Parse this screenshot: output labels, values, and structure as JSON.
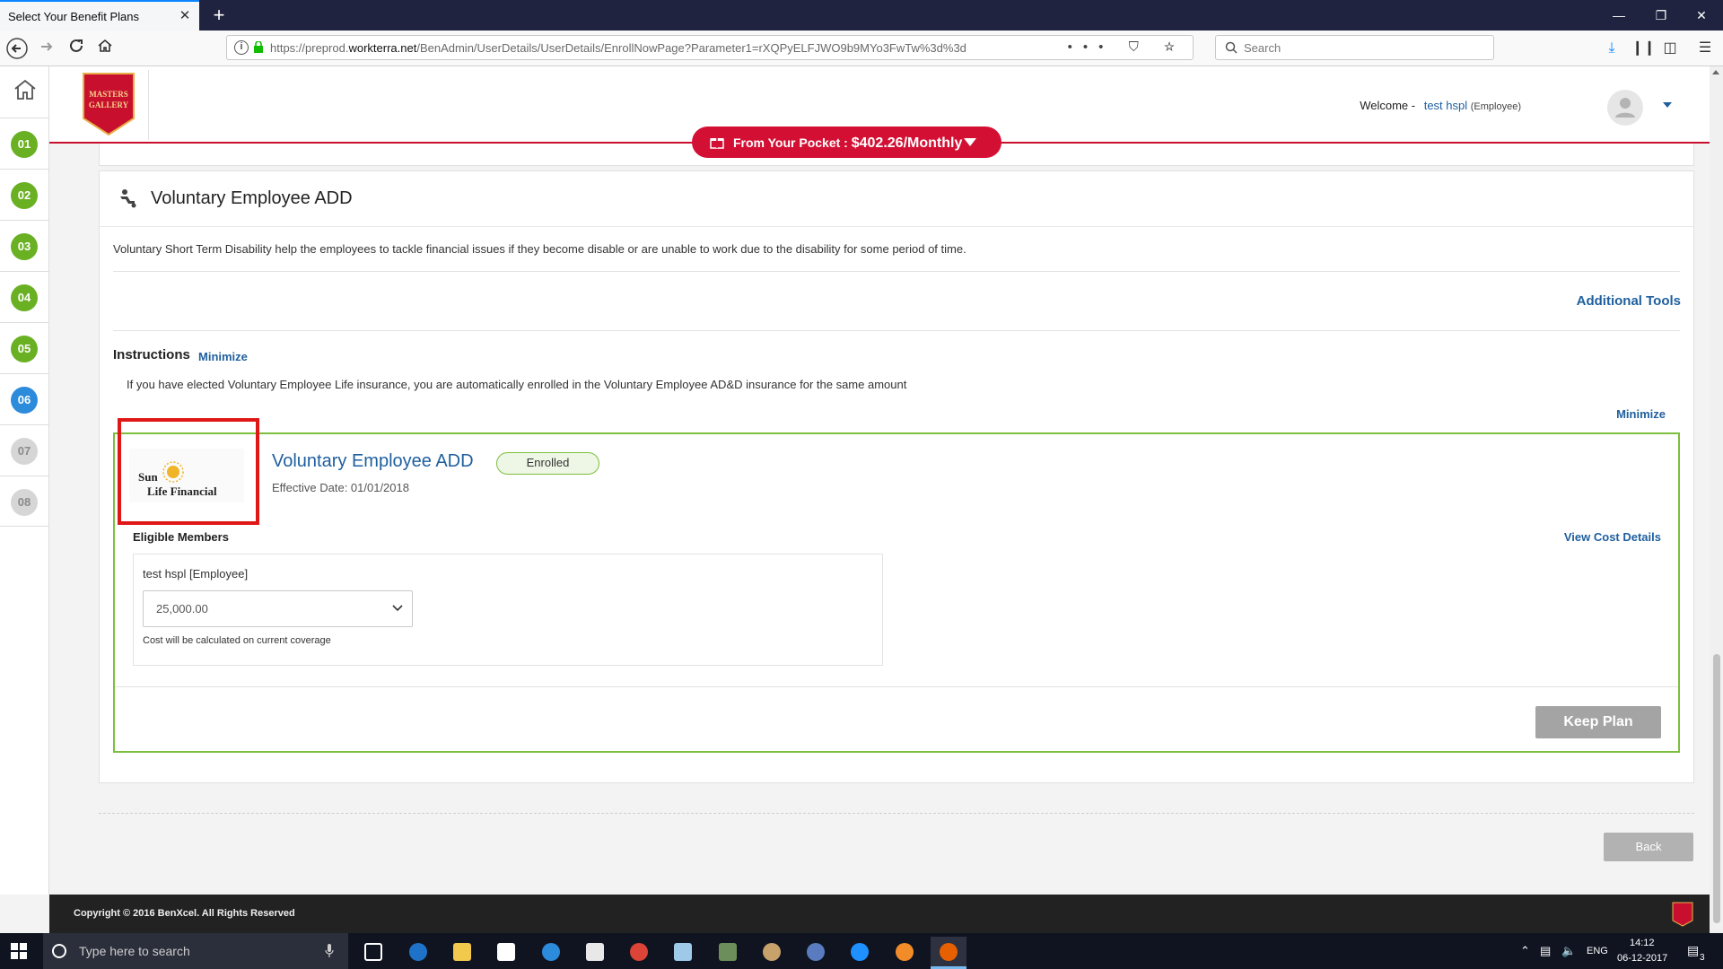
{
  "browser": {
    "tab_title": "Select Your Benefit Plans",
    "tab_close": "✕",
    "new_tab": "+",
    "url_prefix": "https://preprod.",
    "url_domain": "workterra.net",
    "url_path": "/BenAdmin/UserDetails/UserDetails/EnrollNowPage?Parameter1=rXQPyELFJWO9b9MYo3FwTw%3d%3d",
    "search_placeholder": "Search",
    "url_actions": "••• ⛉ ☆"
  },
  "steps": [
    {
      "label": "01",
      "color": "#6ab023"
    },
    {
      "label": "02",
      "color": "#6ab023"
    },
    {
      "label": "03",
      "color": "#6ab023"
    },
    {
      "label": "04",
      "color": "#6ab023"
    },
    {
      "label": "05",
      "color": "#6ab023"
    },
    {
      "label": "06",
      "color": "#2d8bdc"
    },
    {
      "label": "07",
      "color": "#d6d6d6"
    },
    {
      "label": "08",
      "color": "#d6d6d6"
    }
  ],
  "header": {
    "logo_line1": "MASTERS",
    "logo_line2": "GALLERY",
    "welcome_label": "Welcome -",
    "user_name": "test hspl",
    "user_role": "(Employee)"
  },
  "pocket": {
    "label": "From Your Pocket : ",
    "amount": "$402.26/Monthly"
  },
  "section": {
    "title": "Voluntary Employee ADD",
    "description": "Voluntary Short Term Disability help the employees to tackle financial issues if they become disable or are unable to work due to the disability for some period of time.",
    "additional_tools": "Additional Tools",
    "instructions_title": "Instructions",
    "instructions_minimize": "Minimize",
    "instructions_text": "If you have elected Voluntary Employee Life insurance, you are automatically enrolled in the Voluntary Employee AD&D insurance for the same amount",
    "plan_minimize": "Minimize"
  },
  "plan": {
    "carrier_line1": "Sun",
    "carrier_line2": "Life Financial",
    "name": "Voluntary Employee ADD",
    "status": "Enrolled",
    "effective_date": "Effective Date: 01/01/2018",
    "eligible_members_title": "Eligible Members",
    "view_cost_details": "View Cost Details",
    "member_name": "test hspl [Employee]",
    "coverage_value": "25,000.00",
    "coverage_note": "Cost will be calculated on current coverage",
    "keep_plan": "Keep Plan"
  },
  "back_button": "Back",
  "footer": {
    "copyright": "Copyright © 2016 BenXcel. All Rights Reserved"
  },
  "taskbar": {
    "search_placeholder": "Type here to search",
    "language": "ENG",
    "time": "14:12",
    "date": "06-12-2017",
    "notifications": "3"
  },
  "colors": {
    "brand_red": "#c8102e",
    "pocket_red": "#d31034",
    "link_blue": "#1f5f9e",
    "enrolled_green": "#7cbf3e",
    "highlight_red": "#e01717"
  }
}
